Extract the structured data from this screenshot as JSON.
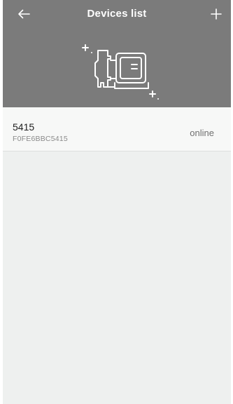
{
  "header": {
    "title": "Devices list",
    "back_icon": "arrow-left-icon",
    "add_icon": "plus-icon",
    "illustration": "pump-icon"
  },
  "colors": {
    "header_bg": "#7b7b7b",
    "page_bg": "#eef0ef",
    "row_bg": "#f7f8f7"
  },
  "devices": [
    {
      "name": "5415",
      "id": "F0FE6BBC5415",
      "status": "online"
    }
  ]
}
